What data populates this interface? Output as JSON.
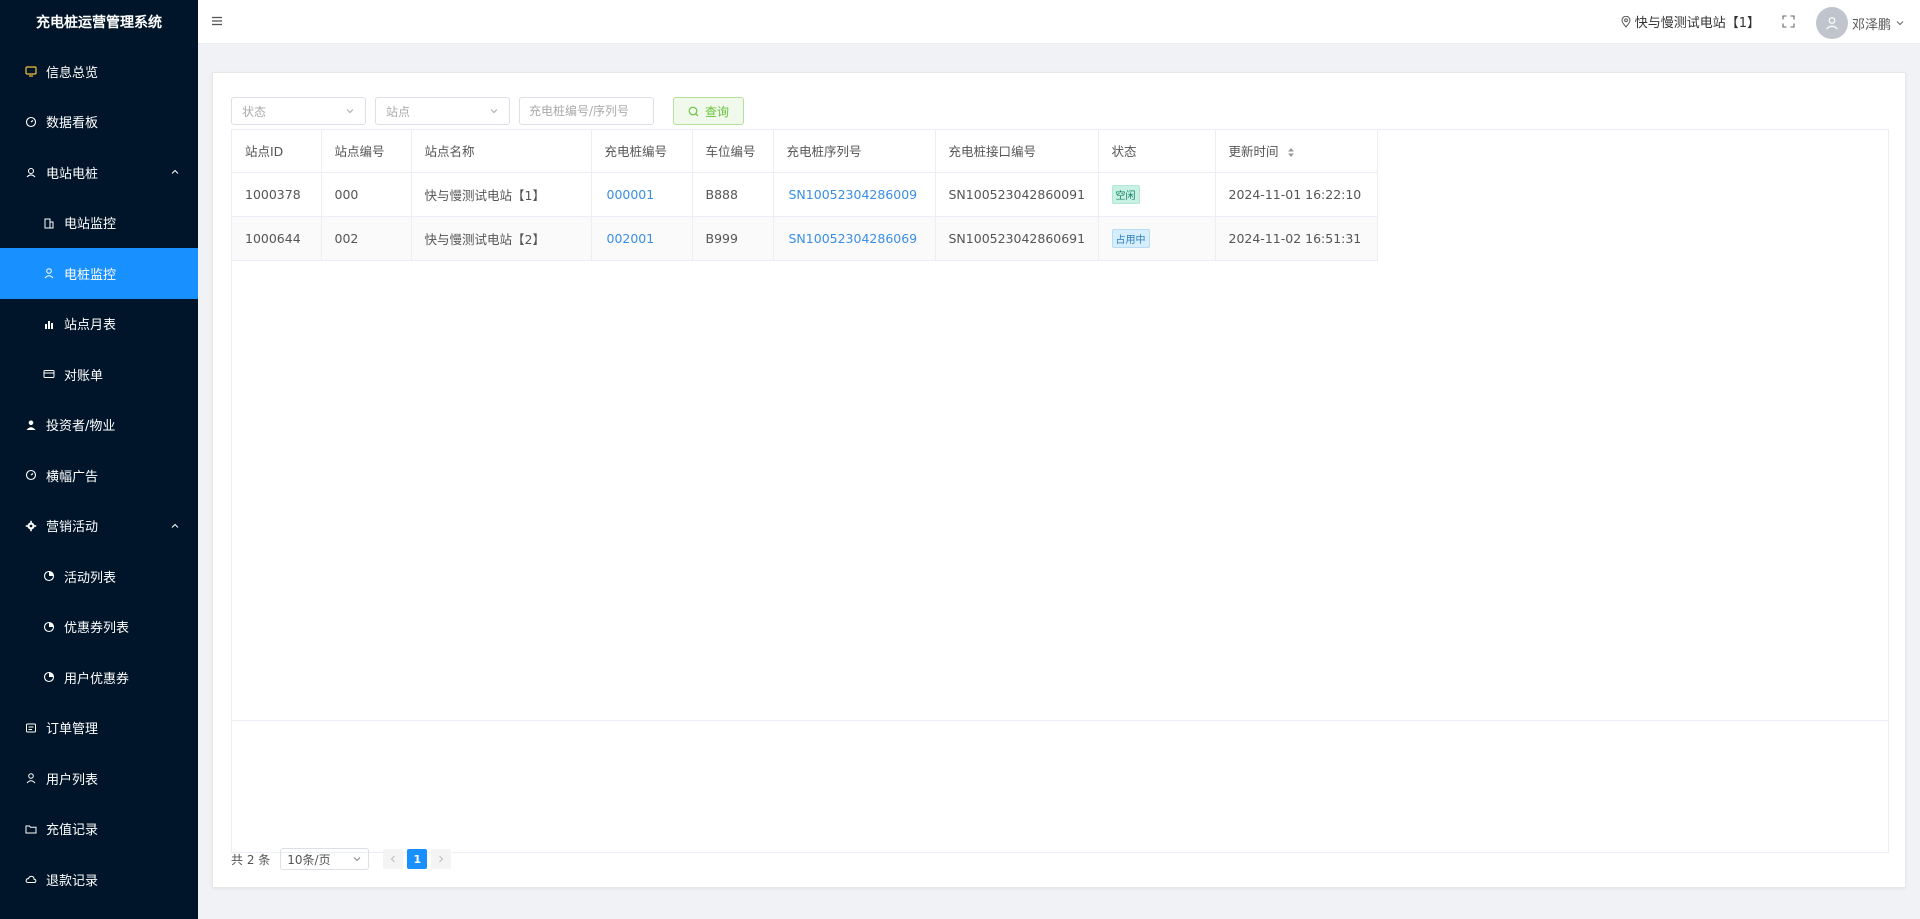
{
  "app": {
    "title": "充电桩运营管理系统"
  },
  "sidebar": {
    "items": [
      {
        "label": "信息总览"
      },
      {
        "label": "数据看板"
      },
      {
        "label": "电站电桩"
      },
      {
        "label": "电站监控"
      },
      {
        "label": "电桩监控"
      },
      {
        "label": "站点月表"
      },
      {
        "label": "对账单"
      },
      {
        "label": "投资者/物业"
      },
      {
        "label": "横幅广告"
      },
      {
        "label": "营销活动"
      },
      {
        "label": "活动列表"
      },
      {
        "label": "优惠券列表"
      },
      {
        "label": "用户优惠券"
      },
      {
        "label": "订单管理"
      },
      {
        "label": "用户列表"
      },
      {
        "label": "充值记录"
      },
      {
        "label": "退款记录"
      }
    ]
  },
  "header": {
    "station": "快与慢测试电站【1】",
    "username": "邓泽鹏"
  },
  "filters": {
    "status_placeholder": "状态",
    "station_placeholder": "站点",
    "pile_placeholder": "充电桩编号/序列号",
    "search_label": "查询"
  },
  "table": {
    "headers": [
      "站点ID",
      "站点编号",
      "站点名称",
      "充电桩编号",
      "车位编号",
      "充电桩序列号",
      "充电桩接口编号",
      "状态",
      "更新时间"
    ],
    "rows": [
      {
        "station_id": "1000378",
        "station_code": "000",
        "station_name": "快与慢测试电站【1】",
        "pile_code": "000001",
        "space_code": "B888",
        "serial": "SN10052304286009",
        "port_code": "SN100523042860091",
        "status": "空闲",
        "updated": "2024-11-01 16:22:10"
      },
      {
        "station_id": "1000644",
        "station_code": "002",
        "station_name": "快与慢测试电站【2】",
        "pile_code": "002001",
        "space_code": "B999",
        "serial": "SN10052304286069",
        "port_code": "SN100523042860691",
        "status": "占用中",
        "updated": "2024-11-02 16:51:31"
      }
    ]
  },
  "pagination": {
    "total": "共 2 条",
    "page_size": "10条/页",
    "current_page": "1"
  },
  "colors": {
    "sidebar_bg": "#001529",
    "accent": "#1890ff",
    "link": "#3a8ee6",
    "search_green": "#67c23a"
  }
}
